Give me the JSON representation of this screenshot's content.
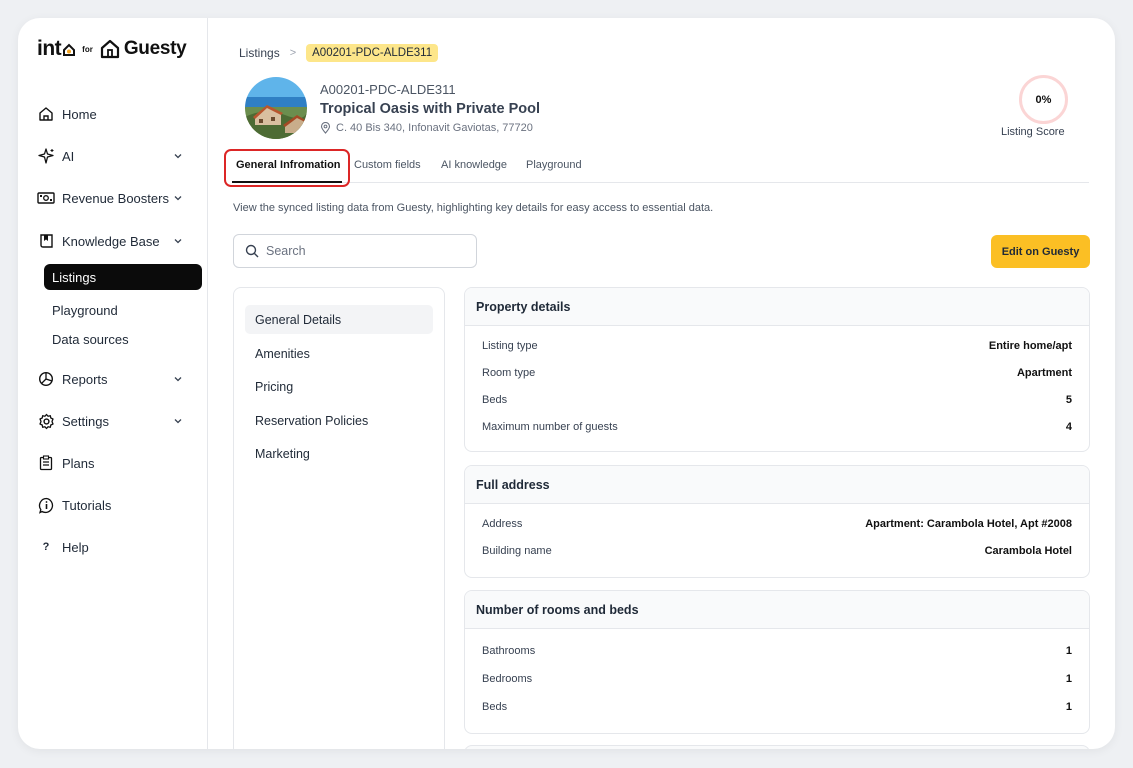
{
  "sidebar": {
    "logo": {
      "into": "int",
      "for": "for",
      "guesty": "Guesty"
    },
    "items": {
      "home": "Home",
      "ai": "AI",
      "revenue": "Revenue Boosters",
      "knowledge": "Knowledge Base",
      "listings": "Listings",
      "playground": "Playground",
      "data_sources": "Data sources",
      "reports": "Reports",
      "settings": "Settings",
      "plans": "Plans",
      "tutorials": "Tutorials",
      "help": "Help"
    }
  },
  "breadcrumb": {
    "root": "Listings",
    "sep": ">",
    "current": "A00201-PDC-ALDE311"
  },
  "listing": {
    "code": "A00201-PDC-ALDE311",
    "title": "Tropical Oasis with Private Pool",
    "address": "C. 40 Bis 340, Infonavit Gaviotas, 77720"
  },
  "score": {
    "value": "0%",
    "label": "Listing Score"
  },
  "tabs": {
    "general": "General Infromation",
    "custom": "Custom fields",
    "ai": "AI knowledge",
    "playground": "Playground"
  },
  "description": "View the synced listing data from Guesty, highlighting key details for easy access to essential data.",
  "search": {
    "placeholder": "Search"
  },
  "edit_button": "Edit on Guesty",
  "sections_nav": {
    "general": "General Details",
    "amenities": "Amenities",
    "pricing": "Pricing",
    "policies": "Reservation Policies",
    "marketing": "Marketing"
  },
  "cards": {
    "property": {
      "title": "Property details",
      "rows": [
        {
          "k": "Listing type",
          "v": "Entire home/apt"
        },
        {
          "k": "Room type",
          "v": "Apartment"
        },
        {
          "k": "Beds",
          "v": "5"
        },
        {
          "k": "Maximum number of guests",
          "v": "4"
        }
      ]
    },
    "address": {
      "title": "Full address",
      "rows": [
        {
          "k": "Address",
          "v": "Apartment: Carambola Hotel, Apt #2008"
        },
        {
          "k": "Building name",
          "v": "Carambola Hotel"
        }
      ]
    },
    "rooms": {
      "title": "Number of rooms and beds",
      "rows": [
        {
          "k": "Bathrooms",
          "v": "1"
        },
        {
          "k": "Bedrooms",
          "v": "1"
        },
        {
          "k": "Beds",
          "v": "1"
        }
      ]
    }
  },
  "colors": {
    "accent": "#fbbf24",
    "badge": "#fde68a",
    "highlight": "#dc2626",
    "active_nav": "#0b0b0b"
  }
}
